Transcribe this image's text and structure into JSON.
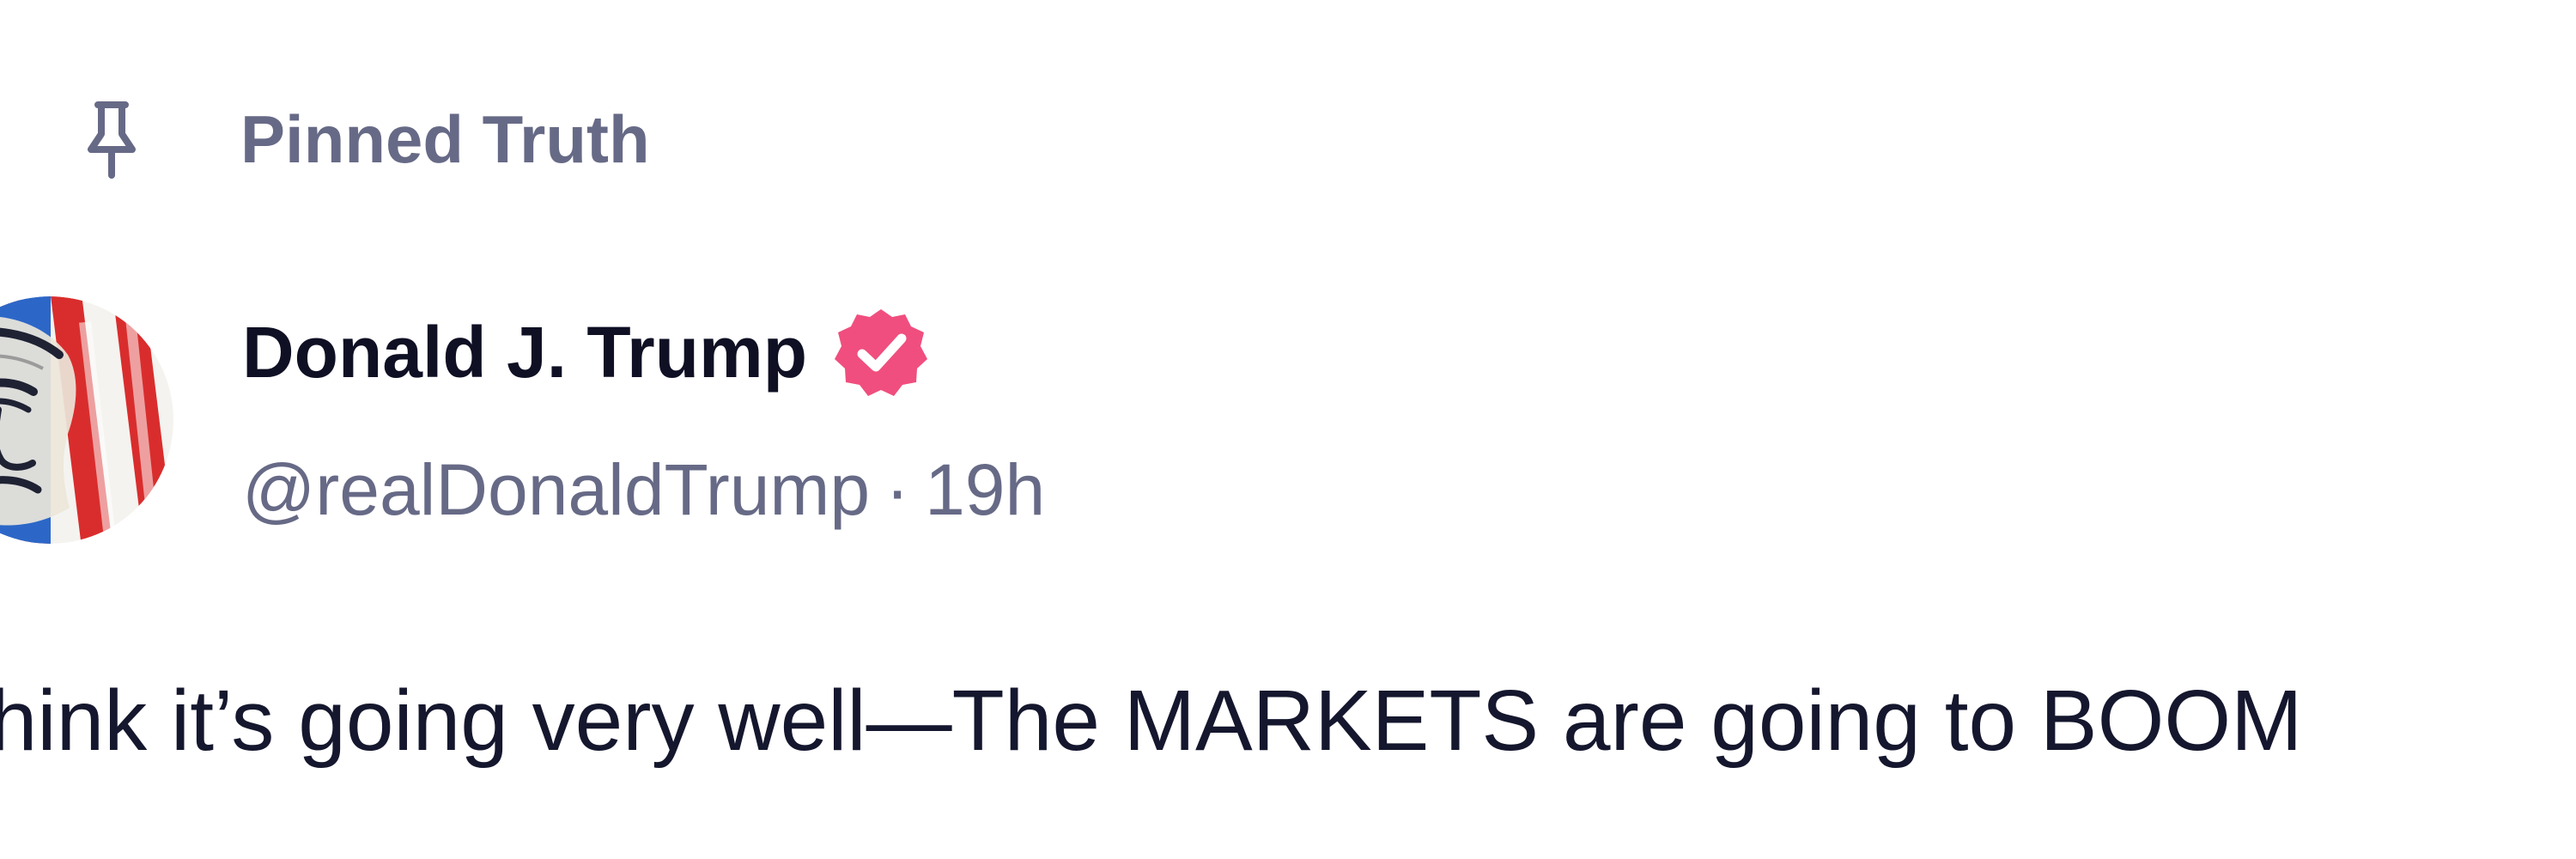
{
  "pinned": {
    "label": "Pinned Truth",
    "icon": "pin-icon"
  },
  "author": {
    "name": "Donald J. Trump",
    "handle": "@realDonaldTrump",
    "separator": "·",
    "time": "19h",
    "verified": true,
    "verified_color": "#f04e7e",
    "avatar_icon": "flag-portrait-avatar"
  },
  "post": {
    "text": "think it’s going very well—The MARKETS are going to BOOM"
  },
  "colors": {
    "muted_text": "#676a86",
    "primary_text": "#0f1024",
    "body_text": "#15172e",
    "background": "#ffffff"
  }
}
